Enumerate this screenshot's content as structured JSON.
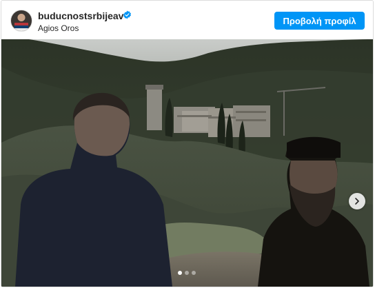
{
  "post": {
    "username": "buducnostsrbijeav",
    "verified_icon": "verified-badge-icon",
    "location": "Agios Oros",
    "view_profile_label": "Προβολή προφίλ",
    "accent_color": "#0095f6"
  },
  "carousel": {
    "slide_count": 3,
    "active_index": 0,
    "next_icon": "chevron-right-icon"
  }
}
